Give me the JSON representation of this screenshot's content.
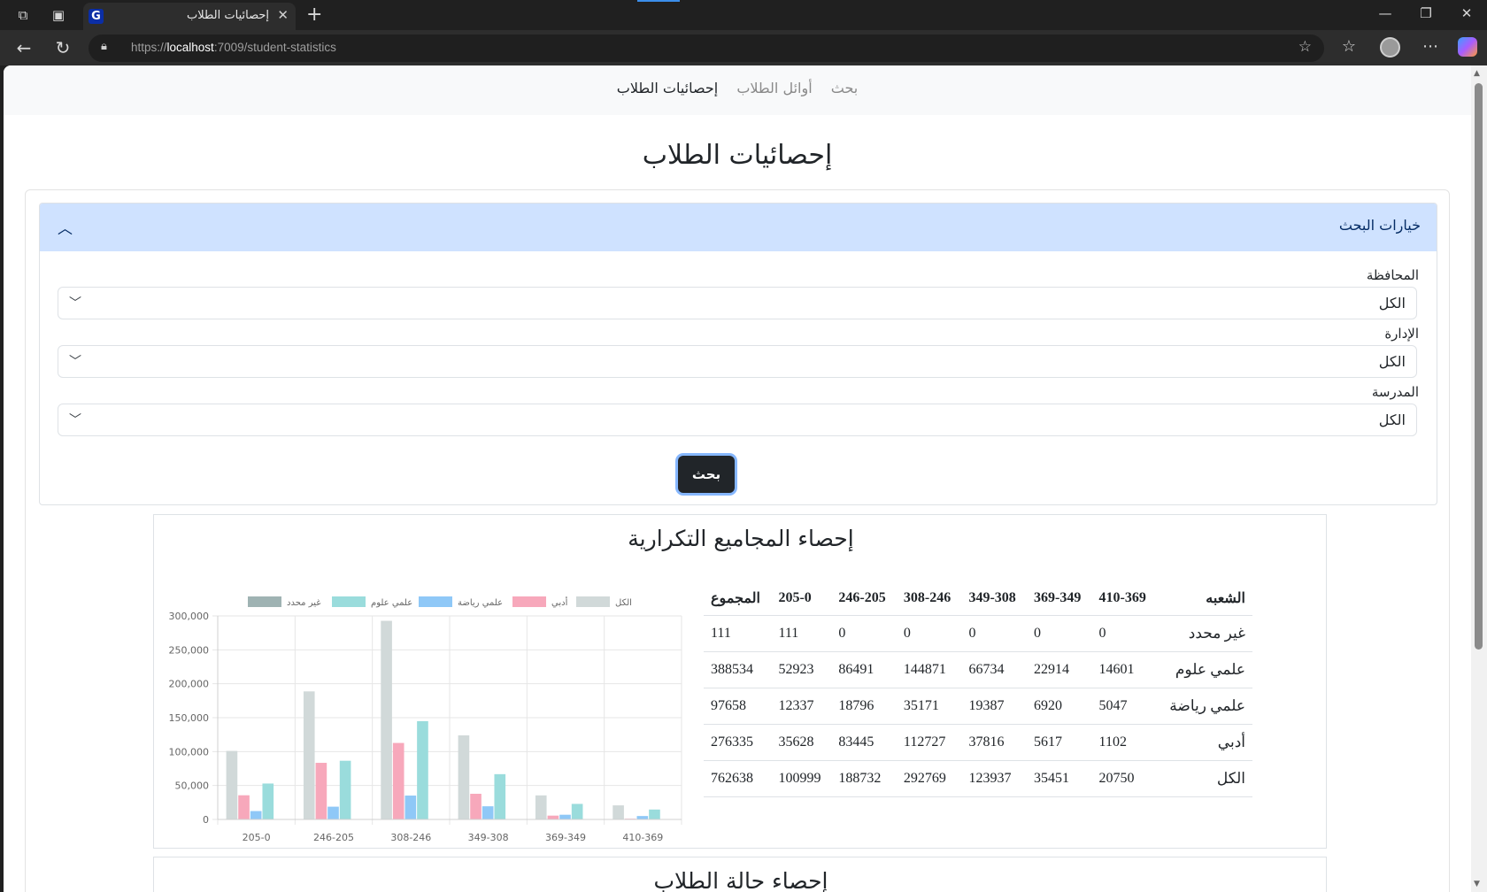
{
  "browser": {
    "tab_title": "إحصائيات الطلاب",
    "favicon_letter": "G",
    "url_scheme": "https://",
    "url_host": "localhost",
    "url_path": ":7009/student-statistics"
  },
  "nav": {
    "links": [
      "بحث",
      "أوائل الطلاب",
      "إحصائيات الطلاب"
    ],
    "active": "إحصائيات الطلاب"
  },
  "page": {
    "title": "إحصائيات الطلاب"
  },
  "search_options": {
    "header": "خيارات البحث",
    "fields": [
      {
        "label": "المحافظة",
        "value": "الكل"
      },
      {
        "label": "الإدارة",
        "value": "الكل"
      },
      {
        "label": "المدرسة",
        "value": "الكل"
      }
    ],
    "button_label": "بحث"
  },
  "frequency_section": {
    "title": "إحصاء المجاميع التكرارية",
    "table": {
      "headers": [
        "الشعبه",
        "410-369",
        "369-349",
        "349-308",
        "308-246",
        "246-205",
        "205-0",
        "المجموع"
      ],
      "rows": [
        [
          "غير محدد",
          "0",
          "0",
          "0",
          "0",
          "0",
          "111",
          "111"
        ],
        [
          "علمي علوم",
          "14601",
          "22914",
          "66734",
          "144871",
          "86491",
          "52923",
          "388534"
        ],
        [
          "علمي رياضة",
          "5047",
          "6920",
          "19387",
          "35171",
          "18796",
          "12337",
          "97658"
        ],
        [
          "أدبي",
          "1102",
          "5617",
          "37816",
          "112727",
          "83445",
          "35628",
          "276335"
        ],
        [
          "الكل",
          "20750",
          "35451",
          "123937",
          "292769",
          "188732",
          "100999",
          "762638"
        ]
      ]
    }
  },
  "status_section": {
    "title": "إحصاء حالة الطلاب"
  },
  "chart_data": {
    "type": "bar",
    "categories": [
      "410-369",
      "369-349",
      "349-308",
      "308-246",
      "246-205",
      "205-0"
    ],
    "series": [
      {
        "name": "غير محدد",
        "color": "#9fb3b3",
        "values": [
          0,
          0,
          0,
          0,
          0,
          111
        ]
      },
      {
        "name": "علمي علوم",
        "color": "#9adcdc",
        "values": [
          14601,
          22914,
          66734,
          144871,
          86491,
          52923
        ]
      },
      {
        "name": "علمي رياضة",
        "color": "#8fc8f7",
        "values": [
          5047,
          6920,
          19387,
          35171,
          18796,
          12337
        ]
      },
      {
        "name": "أدبي",
        "color": "#f7a8bb",
        "values": [
          1102,
          5617,
          37816,
          112727,
          83445,
          35628
        ]
      },
      {
        "name": "الكل",
        "color": "#d1d9d9",
        "values": [
          20750,
          35451,
          123937,
          292769,
          188732,
          100999
        ]
      }
    ],
    "ylim": [
      0,
      300000
    ],
    "yticks": [
      "0",
      "50,000",
      "100,000",
      "150,000",
      "200,000",
      "250,000",
      "300,000"
    ],
    "legend_position": "top",
    "grid": true
  },
  "colors": {
    "accordion_header": "#cfe2ff",
    "button_dark": "#212529",
    "focus_ring": "#86b7fe"
  }
}
